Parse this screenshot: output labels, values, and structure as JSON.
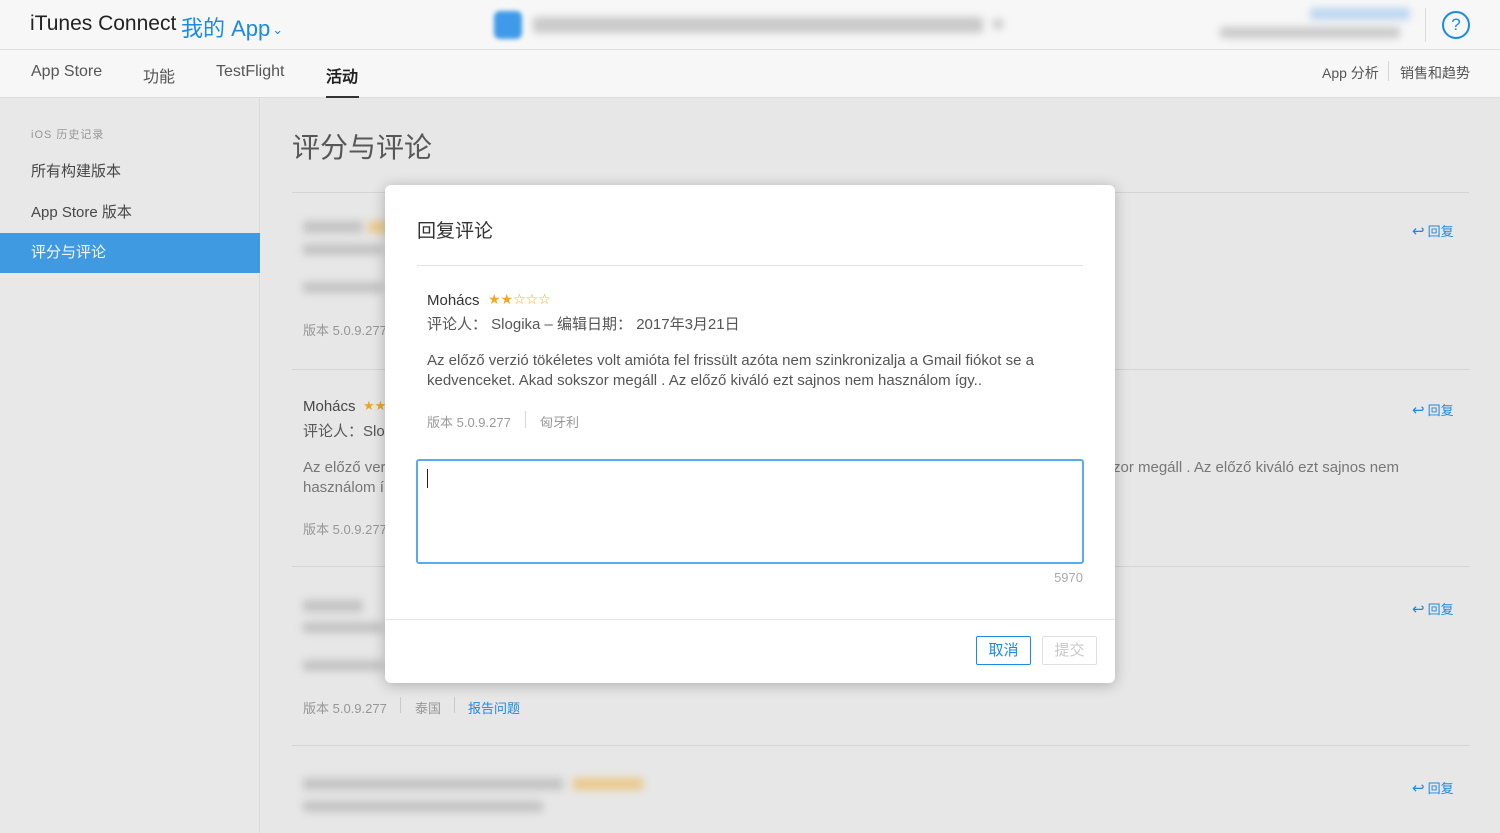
{
  "header": {
    "brand": "iTunes Connect",
    "my_app": "我的 App",
    "help_glyph": "?"
  },
  "nav": {
    "tabs": [
      "App Store",
      "功能",
      "TestFlight",
      "活动"
    ],
    "active": "活动",
    "right": [
      "App 分析",
      "销售和趋势"
    ]
  },
  "sidebar": {
    "heading": "iOS 历史记录",
    "items": [
      "所有构建版本",
      "App Store 版本",
      "评分与评论"
    ],
    "active": "评分与评论"
  },
  "main": {
    "title": "评分与评论",
    "reply_label": "回复",
    "visible_rows": [
      {
        "version": "版本 5.0.9.277"
      },
      {
        "name": "Mohács",
        "by": "评论人：Slo",
        "body_start": "Az előző ver",
        "body_line2": "használom í",
        "body_end": "zor megáll . Az előző kiváló ezt sajnos nem",
        "version": "版本 5.0.9.277"
      },
      {
        "version": "版本 5.0.9.277",
        "country": "泰国",
        "report": "报告问题"
      }
    ]
  },
  "modal": {
    "title": "回复评论",
    "reviewer_title": "Mohács",
    "rating": 2,
    "rating_max": 5,
    "byline": "评论人： Slogika – 编辑日期： 2017年3月21日",
    "body": "Az előző verzió tökéletes volt amióta fel frissült azóta nem szinkronizalja a Gmail fiókot se a kedvenceket. Akad sokszor megáll . Az előző kiváló ezt sajnos nem használom így..",
    "version": "版本 5.0.9.277",
    "country": "匈牙利",
    "reply_value": "",
    "counter": "5970",
    "cancel_label": "取消",
    "submit_label": "提交"
  },
  "colors": {
    "accent": "#1a8ae5",
    "sidebar_active": "#3d9de9",
    "star": "#f5a623"
  }
}
